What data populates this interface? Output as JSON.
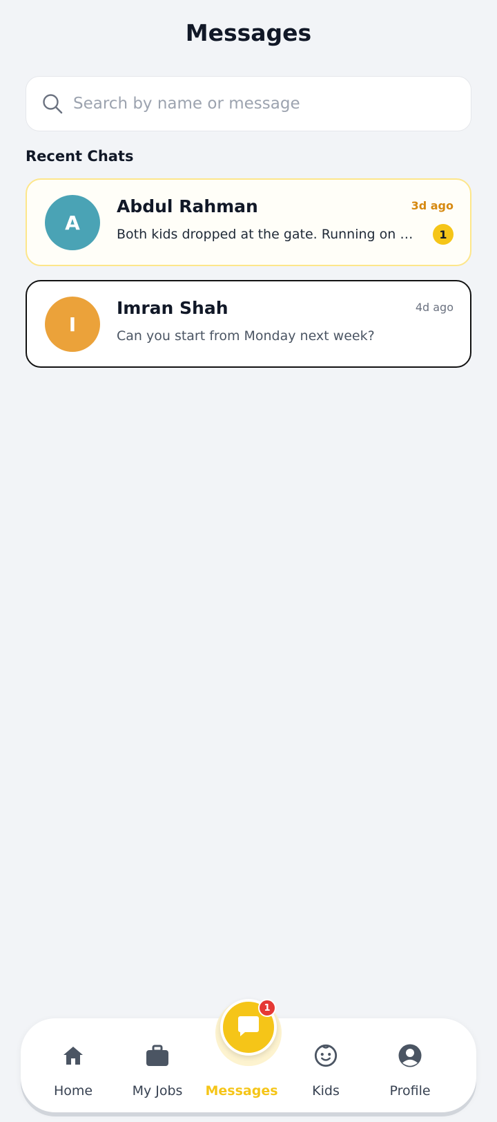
{
  "header": {
    "title": "Messages"
  },
  "search": {
    "placeholder": "Search by name or message",
    "value": ""
  },
  "section": {
    "title": "Recent Chats"
  },
  "chats": [
    {
      "initial": "A",
      "name": "Abdul Rahman",
      "preview": "Both kids dropped at the gate. Running on time.",
      "time": "3d ago",
      "unread_count": "1",
      "avatar_color": "#4aa3b5"
    },
    {
      "initial": "I",
      "name": "Imran Shah",
      "preview": "Can you start from Monday next week?",
      "time": "4d ago",
      "avatar_color": "#eba23a"
    }
  ],
  "nav": {
    "items": [
      {
        "label": "Home",
        "icon": "home-icon"
      },
      {
        "label": "My Jobs",
        "icon": "briefcase-icon"
      },
      {
        "label": "Messages",
        "icon": "chat-icon"
      },
      {
        "label": "Kids",
        "icon": "baby-face-icon"
      },
      {
        "label": "Profile",
        "icon": "user-circle-icon"
      }
    ],
    "messages_badge": "1",
    "active": "Messages"
  },
  "colors": {
    "accent": "#f5c518",
    "background": "#f2f4f7",
    "badge_red": "#e53935"
  }
}
